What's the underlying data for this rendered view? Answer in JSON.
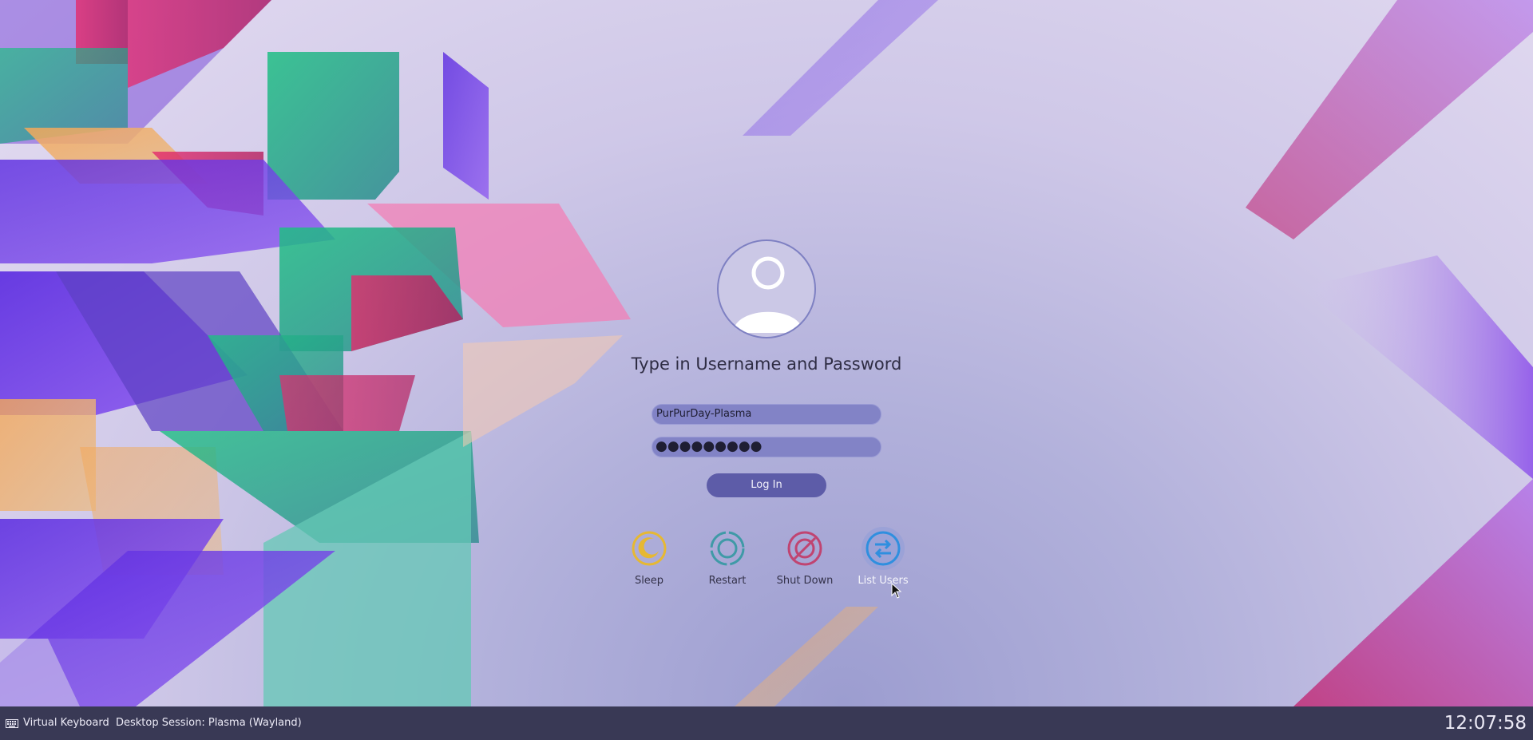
{
  "login": {
    "prompt": "Type in Username and Password",
    "username": "PurPurDay-Plasma",
    "password_mask": "●●●●●●●●●",
    "login_button": "Log In",
    "avatar_icon": "user-avatar-icon"
  },
  "actions": [
    {
      "label": "Sleep",
      "icon": "sleep-icon",
      "color": "#e6b833"
    },
    {
      "label": "Restart",
      "icon": "restart-icon",
      "color": "#3f9aa7"
    },
    {
      "label": "Shut Down",
      "icon": "shutdown-icon",
      "color": "#c04471"
    },
    {
      "label": "List Users",
      "icon": "list-users-icon",
      "color": "#2f8fdf"
    }
  ],
  "taskbar": {
    "virtual_keyboard": "Virtual Keyboard",
    "session": "Desktop Session: Plasma (Wayland)",
    "clock": "12:07:58"
  },
  "colors": {
    "taskbar_bg": "#393955",
    "field_bg": "#8283c6",
    "button_bg": "#5d5ca8"
  }
}
